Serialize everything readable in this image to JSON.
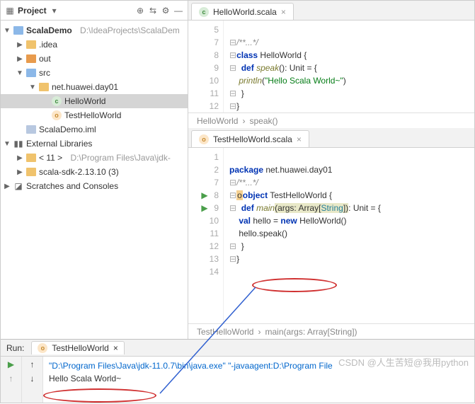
{
  "sidebar": {
    "title": "Project",
    "root": {
      "name": "ScalaDemo",
      "path": "D:\\IdeaProjects\\ScalaDem"
    },
    "items": [
      {
        "name": ".idea"
      },
      {
        "name": "out"
      },
      {
        "name": "src"
      },
      {
        "name": "net.huawei.day01"
      },
      {
        "name": "HelloWorld"
      },
      {
        "name": "TestHelloWorld"
      },
      {
        "name": "ScalaDemo.iml"
      }
    ],
    "external": "External Libraries",
    "lib1": {
      "name": "< 11 >",
      "path": "D:\\Program Files\\Java\\jdk-"
    },
    "lib2": "scala-sdk-2.13.10 (3)",
    "scratches": "Scratches and Consoles"
  },
  "editor1": {
    "tab": "HelloWorld.scala",
    "lines": [
      "5",
      "7",
      "8",
      "9",
      "10",
      "11",
      "12"
    ],
    "code": {
      "l7": "/**...*/",
      "l8a": "class",
      "l8b": " HelloWorld {",
      "l9a": "  def ",
      "l9b": "speak",
      "l9c": "(): Unit = {",
      "l10a": "    println",
      "l10b": "(",
      "l10c": "\"Hello Scala World~\"",
      "l10d": ")",
      "l11": "  }",
      "l12": "}"
    },
    "crumb1": "HelloWorld",
    "crumb2": "speak()"
  },
  "editor2": {
    "tab": "TestHelloWorld.scala",
    "lines": [
      "1",
      "2",
      "7",
      "8",
      "9",
      "10",
      "11",
      "12",
      "13",
      "14"
    ],
    "code": {
      "l1a": "package",
      "l1b": " net.huawei.day01",
      "l7": "/**...*/",
      "l8a": "object",
      "l8b": " TestHelloWorld {",
      "l9a": "  def ",
      "l9b": "main",
      "l9c": "(args: Array[",
      "l9d": "String",
      "l9e": "])",
      "l9f": ": Unit = {",
      "l10a": "    val",
      "l10b": " hello = ",
      "l10c": "new",
      "l10d": " HelloWorld()",
      "l11": "    hello.speak()",
      "l12": "  }",
      "l13": "}"
    },
    "crumb1": "TestHelloWorld",
    "crumb2": "main(args: Array[String])"
  },
  "run": {
    "label": "Run:",
    "tab": "TestHelloWorld",
    "cmd": "\"D:\\Program Files\\Java\\jdk-11.0.7\\bin\\java.exe\" \"-javaagent:D:\\Program File",
    "out": "Hello Scala World~"
  },
  "watermark": "CSDN @人生苦短@我用python"
}
